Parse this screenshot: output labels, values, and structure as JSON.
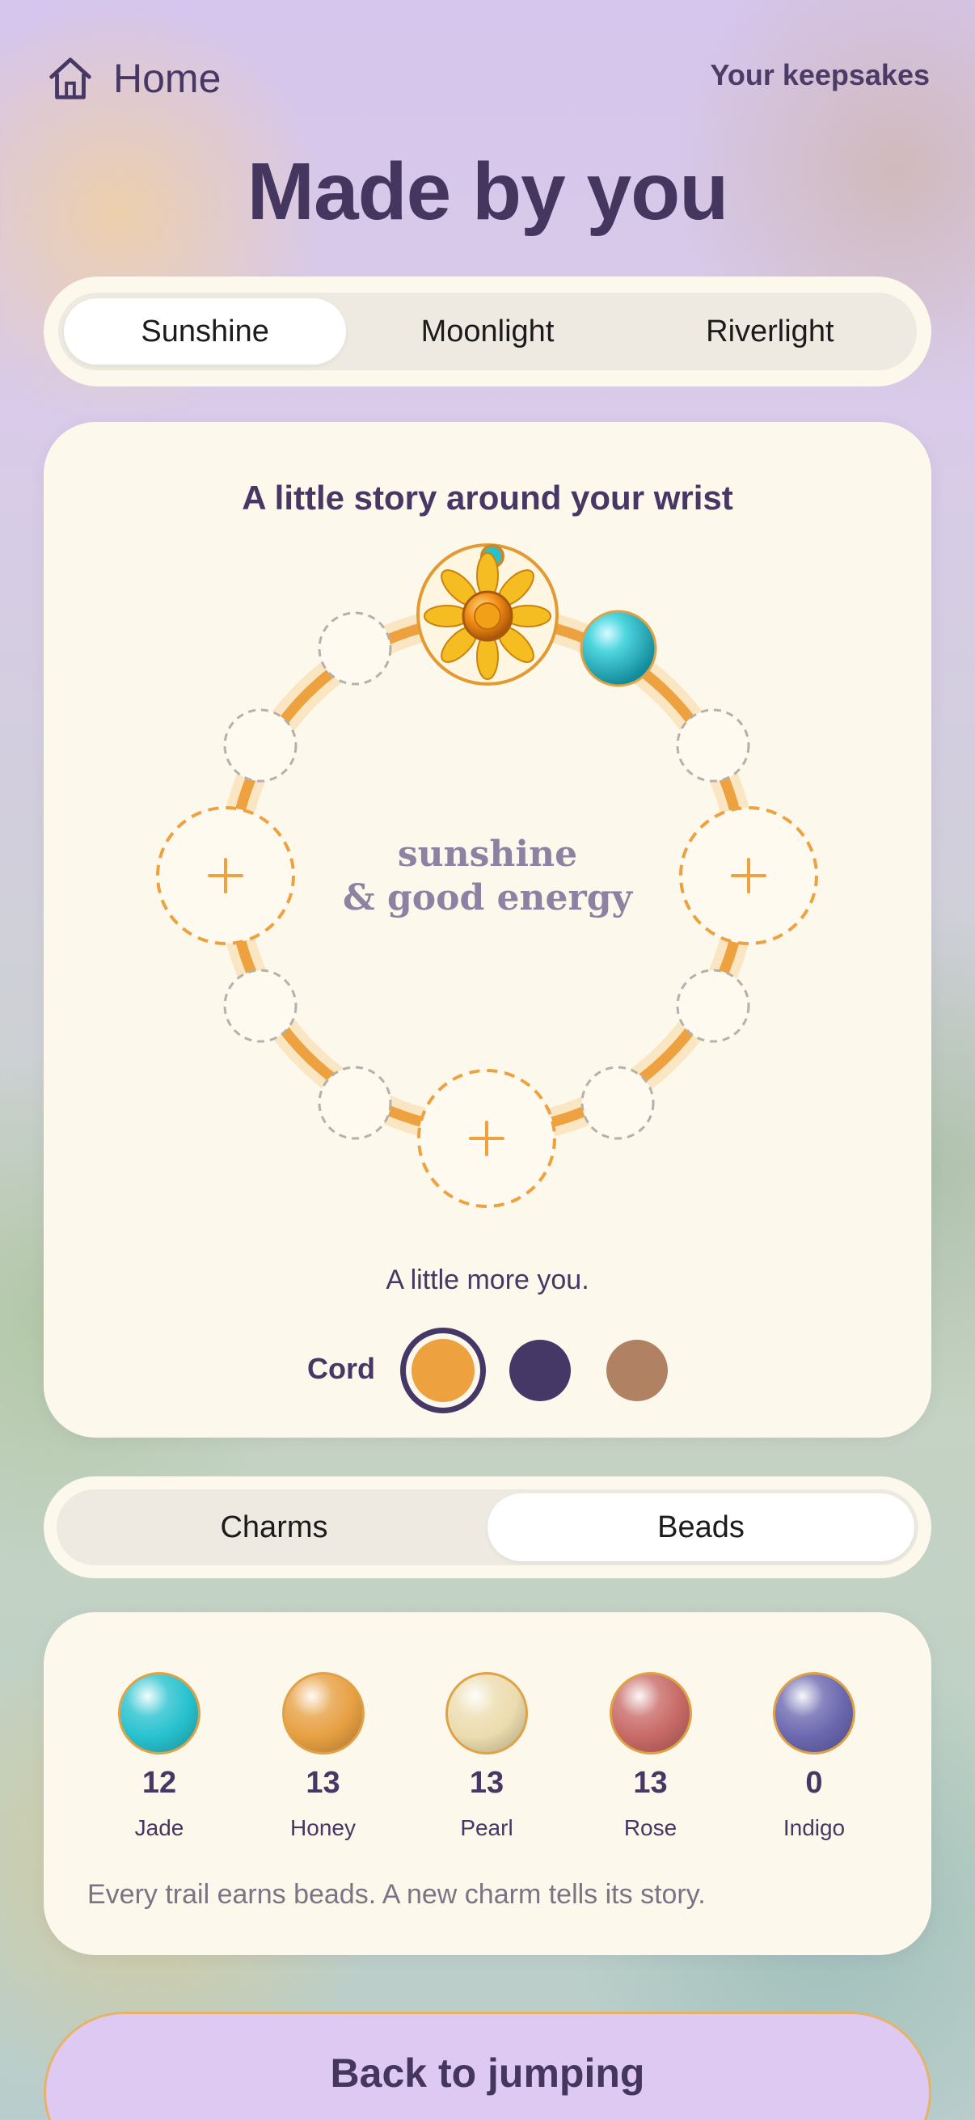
{
  "header": {
    "home_label": "Home",
    "keepsakes_label": "Your keepsakes",
    "title": "Made by you"
  },
  "themes": {
    "tabs": [
      "Sunshine",
      "Moonlight",
      "Riverlight"
    ],
    "selected": "Sunshine"
  },
  "bracelet": {
    "heading": "A little story around your wrist",
    "center_line1": "sunshine",
    "center_line2": "& good energy",
    "charm_icon": "sunflower-charm-icon",
    "placed_bead_color": "#27c2cf",
    "more_text": "A little more you.",
    "cord_label": "Cord",
    "cord_colors": [
      "#eda23f",
      "#453766",
      "#b08263"
    ],
    "selected_cord": "#eda23f"
  },
  "collection_tabs": {
    "tabs": [
      "Charms",
      "Beads"
    ],
    "selected": "Beads"
  },
  "beads": {
    "items": [
      {
        "name": "Jade",
        "count": "12",
        "color": "#27c2cf"
      },
      {
        "name": "Honey",
        "count": "13",
        "color": "#e7a042"
      },
      {
        "name": "Pearl",
        "count": "13",
        "color": "#ecdcae"
      },
      {
        "name": "Rose",
        "count": "13",
        "color": "#c86a67"
      },
      {
        "name": "Indigo",
        "count": "0",
        "color": "#6b68b0"
      }
    ],
    "hint": "Every trail earns beads. A new charm tells its story."
  },
  "footer": {
    "back_label": "Back to jumping"
  },
  "colors": {
    "accent_orange": "#eda23f",
    "text_purple": "#473764",
    "card_bg": "#fdf8ec",
    "button_bg": "#ddc9f2"
  }
}
